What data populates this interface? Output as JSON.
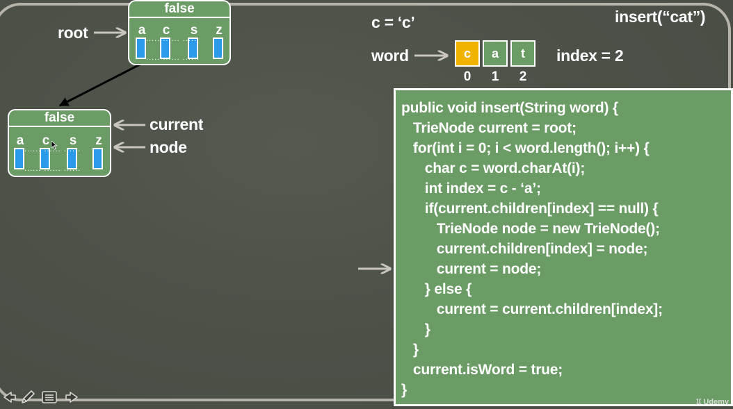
{
  "title": "insert(“cat”)",
  "char_var": "c = ‘c’",
  "word_label": "word",
  "index_text": "index = 2",
  "word_chars": [
    "c",
    "a",
    "t"
  ],
  "word_indices": [
    "0",
    "1",
    "2"
  ],
  "highlight_index": 0,
  "root_label": "root",
  "current_label": "current",
  "node_label": "node",
  "root_node": {
    "header": "false",
    "letters": [
      "a",
      "c",
      "s",
      "z"
    ]
  },
  "new_node": {
    "header": "false",
    "letters": [
      "a",
      "c",
      "s",
      "z"
    ]
  },
  "code_lines": [
    "public void insert(String word) {",
    "   TrieNode current = root;",
    "   for(int i = 0; i < word.length(); i++) {",
    "      char c = word.charAt(i);",
    "      int index = c - ‘a’;",
    "      if(current.children[index] == null) {",
    "         TrieNode node = new TrieNode();",
    "         current.children[index] = node;",
    "         current = node;",
    "      } else {",
    "         current = current.children[index];",
    "      }",
    "   }",
    "   current.isWord = true;",
    "}"
  ],
  "watermark": "Udemy",
  "colors": {
    "node_green": "#6b9c66",
    "slot_blue": "#2b9ae8",
    "highlight": "#f2b300",
    "background": "#4d5249"
  }
}
